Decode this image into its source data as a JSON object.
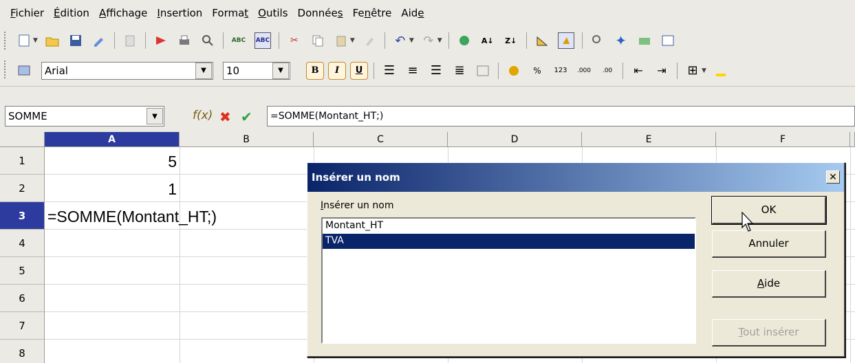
{
  "menu": [
    {
      "label": "Fichier",
      "ul": "F",
      "rest": "ichier"
    },
    {
      "label": "Édition",
      "ul": "É",
      "rest": "dition"
    },
    {
      "label": "Affichage",
      "ul": "A",
      "rest": "ffichage"
    },
    {
      "label": "Insertion",
      "ul": "I",
      "rest": "nsertion"
    },
    {
      "label": "Format",
      "pre": "Forma",
      "ul": "t",
      "rest": ""
    },
    {
      "label": "Outils",
      "ul": "O",
      "rest": "utils"
    },
    {
      "label": "Données",
      "pre": "Donnée",
      "ul": "s",
      "rest": ""
    },
    {
      "label": "Fenêtre",
      "pre": "Fe",
      "ul": "n",
      "rest": "être"
    },
    {
      "label": "Aide",
      "pre": "Aid",
      "ul": "e",
      "rest": ""
    }
  ],
  "font_toolbar": {
    "font_name": "Arial",
    "font_size": "10"
  },
  "formula_bar": {
    "name_box": "SOMME",
    "formula": "=SOMME(Montant_HT;)"
  },
  "sheet": {
    "columns": [
      "A",
      "B",
      "C",
      "D",
      "E",
      "F"
    ],
    "rows": [
      "1",
      "2",
      "3",
      "4",
      "5",
      "6",
      "7",
      "8"
    ],
    "selected_column": "A",
    "selected_row": "3",
    "cells": {
      "A1": "5",
      "A2": "1",
      "A3": "=SOMME(Montant_HT;)"
    }
  },
  "dialog": {
    "title": "Insérer un nom",
    "close": "✕",
    "label": "Insérer un nom",
    "label_ul": "I",
    "label_rest": "nsérer un nom",
    "names": [
      "Montant_HT",
      "TVA"
    ],
    "selected_name": "TVA",
    "buttons": {
      "ok": "OK",
      "cancel": "Annuler",
      "help_ul": "A",
      "help_rest": "ide",
      "insert_all_ul": "T",
      "insert_all_rest": "out insérer"
    }
  },
  "colors": {
    "accent": "#0a246a",
    "selection": "#2d3b9e",
    "face": "#ece9d8"
  }
}
